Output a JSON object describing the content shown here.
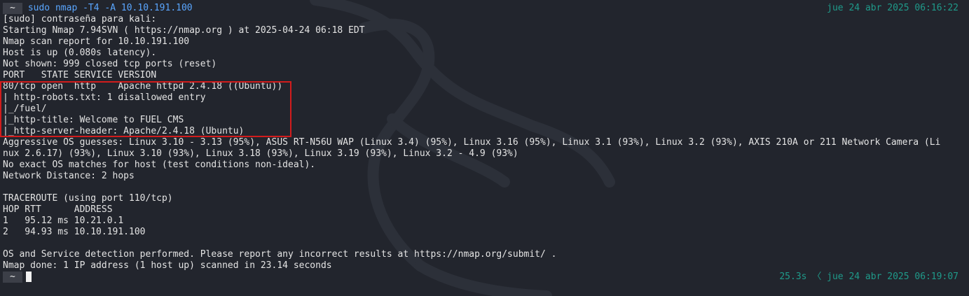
{
  "prompt": {
    "symbol": "~",
    "command": "sudo nmap -T4 -A 10.10.191.100",
    "datetime": "jue 24 abr 2025 06:16:22"
  },
  "output_lines": [
    "[sudo] contraseña para kali:",
    "Starting Nmap 7.94SVN ( https://nmap.org ) at 2025-04-24 06:18 EDT",
    "Nmap scan report for 10.10.191.100",
    "Host is up (0.080s latency).",
    "Not shown: 999 closed tcp ports (reset)",
    "PORT   STATE SERVICE VERSION",
    "80/tcp open  http    Apache httpd 2.4.18 ((Ubuntu))",
    "| http-robots.txt: 1 disallowed entry",
    "|_/fuel/",
    "|_http-title: Welcome to FUEL CMS",
    "|_http-server-header: Apache/2.4.18 (Ubuntu)",
    "Aggressive OS guesses: Linux 3.10 - 3.13 (95%), ASUS RT-N56U WAP (Linux 3.4) (95%), Linux 3.16 (95%), Linux 3.1 (93%), Linux 3.2 (93%), AXIS 210A or 211 Network Camera (Li",
    "nux 2.6.17) (93%), Linux 3.10 (93%), Linux 3.18 (93%), Linux 3.19 (93%), Linux 3.2 - 4.9 (93%)",
    "No exact OS matches for host (test conditions non-ideal).",
    "Network Distance: 2 hops",
    "",
    "TRACEROUTE (using port 110/tcp)",
    "HOP RTT      ADDRESS",
    "1   95.12 ms 10.21.0.1",
    "2   94.93 ms 10.10.191.100",
    "",
    "OS and Service detection performed. Please report any incorrect results at https://nmap.org/submit/ .",
    "Nmap done: 1 IP address (1 host up) scanned in 23.14 seconds"
  ],
  "final_prompt": {
    "symbol": "~",
    "status": "25.3s 〈 jue 24 abr 2025 06:19:07"
  },
  "colors": {
    "background": "#22252d",
    "text": "#e4e4e4",
    "command": "#5aa6ff",
    "datetime": "#1f9a8a",
    "highlight_border": "#d21c1c"
  }
}
